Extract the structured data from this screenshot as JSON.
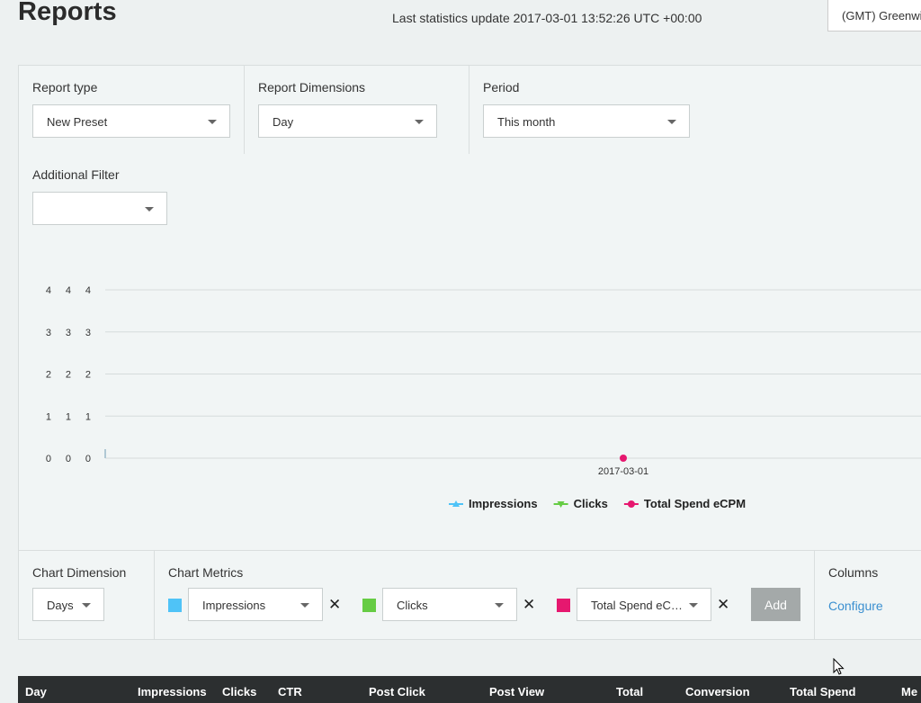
{
  "header": {
    "title": "Reports",
    "last_update": "Last statistics update 2017-03-01 13:52:26 UTC +00:00",
    "timezone": "(GMT) Greenwich"
  },
  "filters": {
    "report_type": {
      "label": "Report type",
      "value": "New Preset"
    },
    "report_dimensions": {
      "label": "Report Dimensions",
      "value": "Day"
    },
    "period": {
      "label": "Period",
      "value": "This month"
    },
    "additional_filter": {
      "label": "Additional Filter",
      "value": ""
    }
  },
  "chart_data": {
    "type": "line",
    "x": [
      "2017-03-01"
    ],
    "y_axes": [
      {
        "ticks": [
          0,
          1,
          2,
          3,
          4
        ],
        "color": "#4fc3f7"
      },
      {
        "ticks": [
          0,
          1,
          2,
          3,
          4
        ],
        "color": "#66cc44"
      },
      {
        "ticks": [
          0,
          1,
          2,
          3,
          4
        ],
        "color": "#e6186f"
      }
    ],
    "ylim": [
      0,
      4
    ],
    "series": [
      {
        "name": "Impressions",
        "values": [
          0
        ],
        "color": "#4fc3f7",
        "marker": "triangle"
      },
      {
        "name": "Clicks",
        "values": [
          0
        ],
        "color": "#66cc44",
        "marker": "triangle-down"
      },
      {
        "name": "Total Spend eCPM",
        "values": [
          0
        ],
        "color": "#e6186f",
        "marker": "circle"
      }
    ],
    "grid": true,
    "legend": "bottom-center"
  },
  "controls": {
    "chart_dimension": {
      "label": "Chart Dimension",
      "value": "Days"
    },
    "chart_metrics": {
      "label": "Chart Metrics",
      "items": [
        {
          "value": "Impressions",
          "color": "#4fc3f7"
        },
        {
          "value": "Clicks",
          "color": "#66cc44"
        },
        {
          "value": "Total Spend eCP…",
          "color": "#e6186f"
        }
      ],
      "add_label": "Add"
    },
    "columns": {
      "label": "Columns",
      "configure_label": "Configure"
    }
  },
  "table": {
    "headers": [
      "Day",
      "Impressions",
      "Clicks",
      "CTR",
      "Post Click",
      "Post View",
      "Total",
      "Conversion",
      "Total Spend",
      "Me"
    ]
  },
  "icons": {
    "remove": "close-icon",
    "dropdown": "chevron-down-icon"
  }
}
